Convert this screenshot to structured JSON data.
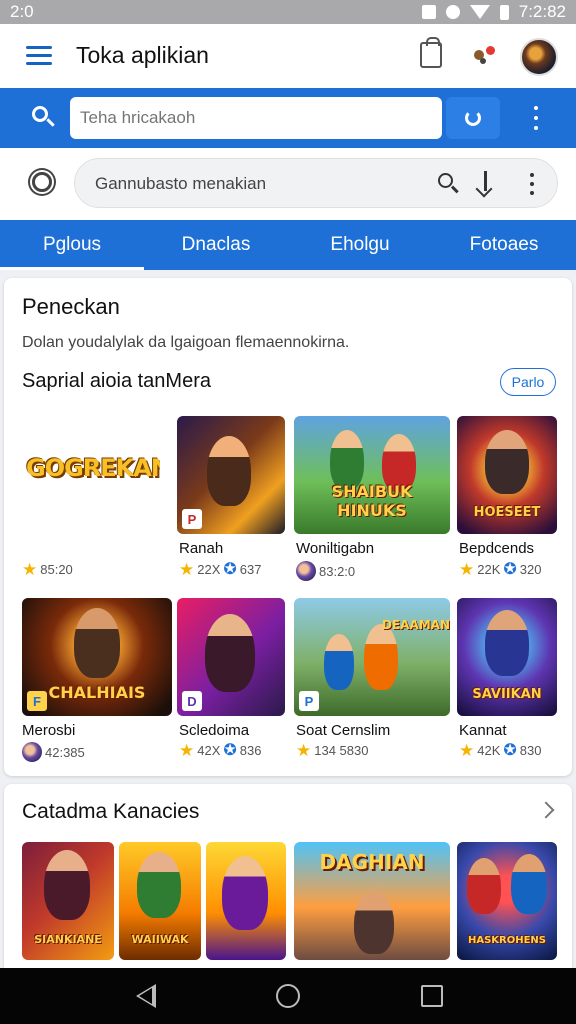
{
  "status": {
    "time": "7:2:82",
    "left_text": "2:0"
  },
  "header": {
    "title": "Toka aplikian"
  },
  "search": {
    "placeholder": "Teha hricakaoh"
  },
  "filter": {
    "placeholder": "Gannubasto menakian"
  },
  "tabs": [
    "Pglous",
    "Dnaclas",
    "Eholgu",
    "Fotoaes"
  ],
  "recommend": {
    "title": "Peneckan",
    "description": "Dolan youdalylak da lgaigoan flemaennokirna.",
    "subtitle": "Saprial aioia tanMera",
    "more_label": "Parlo",
    "row1": [
      {
        "name": "",
        "tile_title": "GOGREKAN",
        "rating": "85:20",
        "extra": ""
      },
      {
        "name": "Ranah",
        "tile_title": "",
        "rating": "22X",
        "extra": "637"
      },
      {
        "name": "Woniltigabn",
        "tile_title": "SHAIBUK HINUKS",
        "rating": "83:2:0",
        "extra": ""
      },
      {
        "name": "Bepdcends",
        "tile_title": "HOESEET",
        "rating": "22K",
        "extra": "320"
      }
    ],
    "row2": [
      {
        "name": "Merosbi",
        "tile_title": "CHALHIAIS",
        "rating": "42:385",
        "extra": ""
      },
      {
        "name": "Scledoima",
        "tile_title": "",
        "rating": "42X",
        "extra": "836"
      },
      {
        "name": "Soat Cernslim",
        "tile_title": "DEAAMAN",
        "rating": "134 5830",
        "extra": ""
      },
      {
        "name": "Kannat",
        "tile_title": "SAVIIKAN",
        "rating": "42K",
        "extra": "830"
      }
    ]
  },
  "categories": {
    "title": "Catadma Kanacies",
    "tiles": [
      "SIANKIANE",
      "WAIIWAK",
      "",
      "DAGHIAN",
      "HASKROHENS"
    ]
  },
  "colors": {
    "primary": "#1e70d6",
    "star": "#f5b400",
    "nav_bg": "#050505"
  }
}
